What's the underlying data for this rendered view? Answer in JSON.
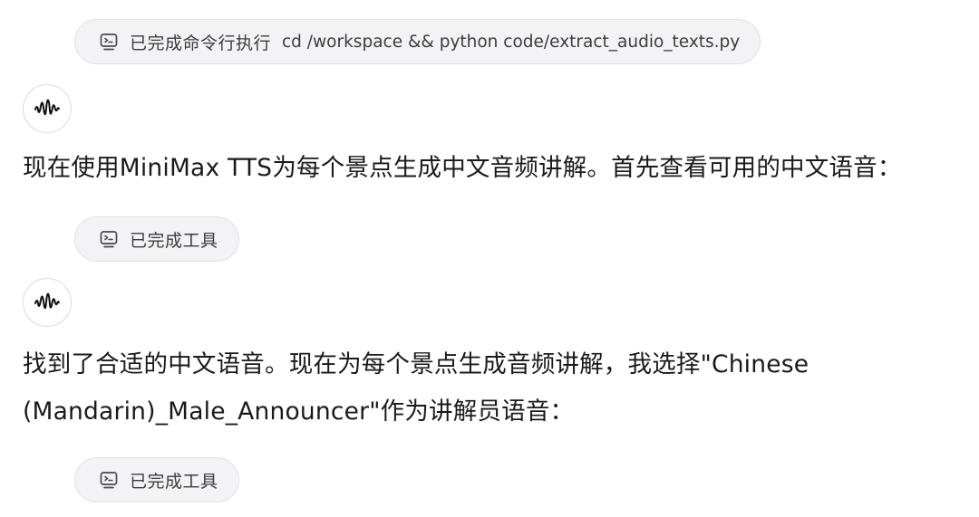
{
  "steps": [
    {
      "type": "tool",
      "status": "已完成命令行执行",
      "command": "cd /workspace && python code/extract_audio_texts.py",
      "icon": "terminal-icon"
    },
    {
      "type": "assistant",
      "icon": "waveform-logo-icon",
      "text": "现在使用MiniMax TTS为每个景点生成中文音频讲解。首先查看可用的中文语音："
    },
    {
      "type": "tool",
      "status": "已完成工具",
      "icon": "terminal-icon"
    },
    {
      "type": "assistant",
      "icon": "waveform-logo-icon",
      "text_line1": "找到了合适的中文语音。现在为每个景点生成音频讲解，我选择\"Chinese",
      "text_line2": "(Mandarin)_Male_Announcer\"作为讲解员语音："
    },
    {
      "type": "tool",
      "status": "已完成工具",
      "icon": "terminal-icon"
    }
  ],
  "colors": {
    "pill_background": "#f3f3f5",
    "pill_border": "#e1e1e4",
    "text_primary": "#1a1a1a",
    "text_secondary": "#3c3c3c"
  }
}
